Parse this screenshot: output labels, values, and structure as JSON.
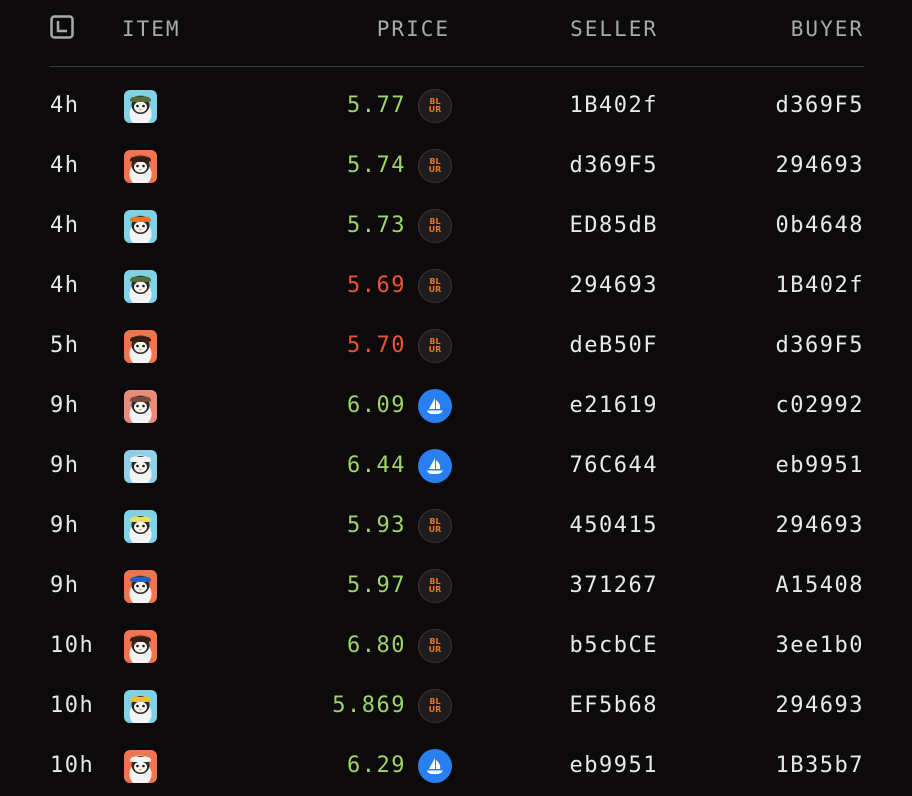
{
  "header": {
    "item": "ITEM",
    "price": "PRICE",
    "seller": "SELLER",
    "buyer": "BUYER",
    "time_icon": "clock-icon"
  },
  "colors": {
    "up": "#9ed46a",
    "down": "#ea5533",
    "blur": "#f0711b",
    "opensea": "#2a7ff0"
  },
  "rows": [
    {
      "time": "4h",
      "avatar": {
        "bg": "#7fd3e6",
        "hat": "#5a6a3a"
      },
      "price": "5.77",
      "trend": "up",
      "market": "blur",
      "seller": "1B402f",
      "buyer": "d369F5"
    },
    {
      "time": "4h",
      "avatar": {
        "bg": "#f0754e",
        "hat": "#3a1e12"
      },
      "price": "5.74",
      "trend": "up",
      "market": "blur",
      "seller": "d369F5",
      "buyer": "294693"
    },
    {
      "time": "4h",
      "avatar": {
        "bg": "#7fd3e6",
        "hat": "#e0742a"
      },
      "price": "5.73",
      "trend": "up",
      "market": "blur",
      "seller": "ED85dB",
      "buyer": "0b4648"
    },
    {
      "time": "4h",
      "avatar": {
        "bg": "#7fd3e6",
        "hat": "#5a6a3a"
      },
      "price": "5.69",
      "trend": "down",
      "market": "blur",
      "seller": "294693",
      "buyer": "1B402f"
    },
    {
      "time": "5h",
      "avatar": {
        "bg": "#f0754e",
        "hat": "#3a1e12"
      },
      "price": "5.70",
      "trend": "down",
      "market": "blur",
      "seller": "deB50F",
      "buyer": "d369F5"
    },
    {
      "time": "9h",
      "avatar": {
        "bg": "#e98a7a",
        "hat": "#7a4a3a"
      },
      "price": "6.09",
      "trend": "up",
      "market": "opensea",
      "seller": "e21619",
      "buyer": "c02992"
    },
    {
      "time": "9h",
      "avatar": {
        "bg": "#8fd0e8",
        "hat": "#f2f2f2"
      },
      "price": "6.44",
      "trend": "up",
      "market": "opensea",
      "seller": "76C644",
      "buyer": "eb9951"
    },
    {
      "time": "9h",
      "avatar": {
        "bg": "#7fd3e6",
        "hat": "#e8e060"
      },
      "price": "5.93",
      "trend": "up",
      "market": "blur",
      "seller": "450415",
      "buyer": "294693"
    },
    {
      "time": "9h",
      "avatar": {
        "bg": "#f0754e",
        "hat": "#2b5fbf"
      },
      "price": "5.97",
      "trend": "up",
      "market": "blur",
      "seller": "371267",
      "buyer": "A15408"
    },
    {
      "time": "10h",
      "avatar": {
        "bg": "#f0754e",
        "hat": "#3a1e12"
      },
      "price": "6.80",
      "trend": "up",
      "market": "blur",
      "seller": "b5cbCE",
      "buyer": "3ee1b0"
    },
    {
      "time": "10h",
      "avatar": {
        "bg": "#7fd3e6",
        "hat": "#e8c030"
      },
      "price": "5.869",
      "trend": "up",
      "market": "blur",
      "seller": "EF5b68",
      "buyer": "294693"
    },
    {
      "time": "10h",
      "avatar": {
        "bg": "#f0754e",
        "hat": "#f2f2f2"
      },
      "price": "6.29",
      "trend": "up",
      "market": "opensea",
      "seller": "eb9951",
      "buyer": "1B35b7"
    }
  ]
}
